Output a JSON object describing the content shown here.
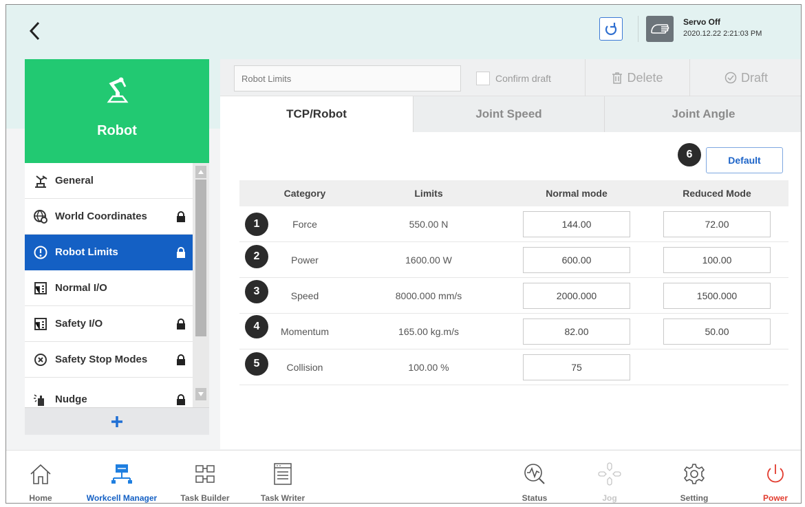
{
  "colors": {
    "accent": "#1460c4",
    "robot_header": "#22c972",
    "power": "#e23b2e",
    "topbar": "#e3f2f1"
  },
  "header": {
    "back_icon": "chevron-left-icon",
    "refresh_icon": "refresh-icon",
    "servo_icon": "hand-icon",
    "servo_status": "Servo Off",
    "datetime": "2020.12.22 2:21:03 PM"
  },
  "sidebar": {
    "title": "Robot",
    "title_icon": "robot-arm-icon",
    "items": [
      {
        "label": "General",
        "icon": "robot-base-icon",
        "locked": false
      },
      {
        "label": "World Coordinates",
        "icon": "globe-gear-icon",
        "locked": true
      },
      {
        "label": "Robot Limits",
        "icon": "exclamation-circle-icon",
        "locked": true,
        "active": true
      },
      {
        "label": "Normal I/O",
        "icon": "io-port-icon",
        "locked": false
      },
      {
        "label": "Safety I/O",
        "icon": "io-port-icon",
        "locked": true
      },
      {
        "label": "Safety Stop Modes",
        "icon": "x-circle-icon",
        "locked": true
      },
      {
        "label": "Nudge",
        "icon": "nudge-hand-icon",
        "locked": true
      }
    ],
    "add_label": "+"
  },
  "toolbar": {
    "name_placeholder": "Robot Limits",
    "confirm_label": "Confirm draft",
    "delete_label": "Delete",
    "draft_label": "Draft"
  },
  "tabs": [
    {
      "label": "TCP/Robot",
      "active": true
    },
    {
      "label": "Joint Speed",
      "active": false
    },
    {
      "label": "Joint Angle",
      "active": false
    }
  ],
  "default_badge": "6",
  "default_label": "Default",
  "table": {
    "headers": [
      "Category",
      "Limits",
      "Normal mode",
      "Reduced Mode"
    ],
    "rows": [
      {
        "badge": "1",
        "category": "Force",
        "limit": "550.00 N",
        "normal": "144.00",
        "reduced": "72.00"
      },
      {
        "badge": "2",
        "category": "Power",
        "limit": "1600.00 W",
        "normal": "600.00",
        "reduced": "100.00"
      },
      {
        "badge": "3",
        "category": "Speed",
        "limit": "8000.000 mm/s",
        "normal": "2000.000",
        "reduced": "1500.000"
      },
      {
        "badge": "4",
        "category": "Momentum",
        "limit": "165.00 kg.m/s",
        "normal": "82.00",
        "reduced": "50.00"
      },
      {
        "badge": "5",
        "category": "Collision",
        "limit": "100.00 %",
        "normal": "75",
        "reduced": null
      }
    ]
  },
  "nav": [
    {
      "label": "Home",
      "icon": "home-icon"
    },
    {
      "label": "Workcell Manager",
      "icon": "workcell-icon",
      "active": true
    },
    {
      "label": "Task Builder",
      "icon": "task-builder-icon"
    },
    {
      "label": "Task Writer",
      "icon": "task-writer-icon"
    },
    {
      "label": "Status",
      "icon": "status-icon"
    },
    {
      "label": "Jog",
      "icon": "jog-icon",
      "disabled": true
    },
    {
      "label": "Setting",
      "icon": "gear-icon"
    },
    {
      "label": "Power",
      "icon": "power-icon"
    }
  ]
}
